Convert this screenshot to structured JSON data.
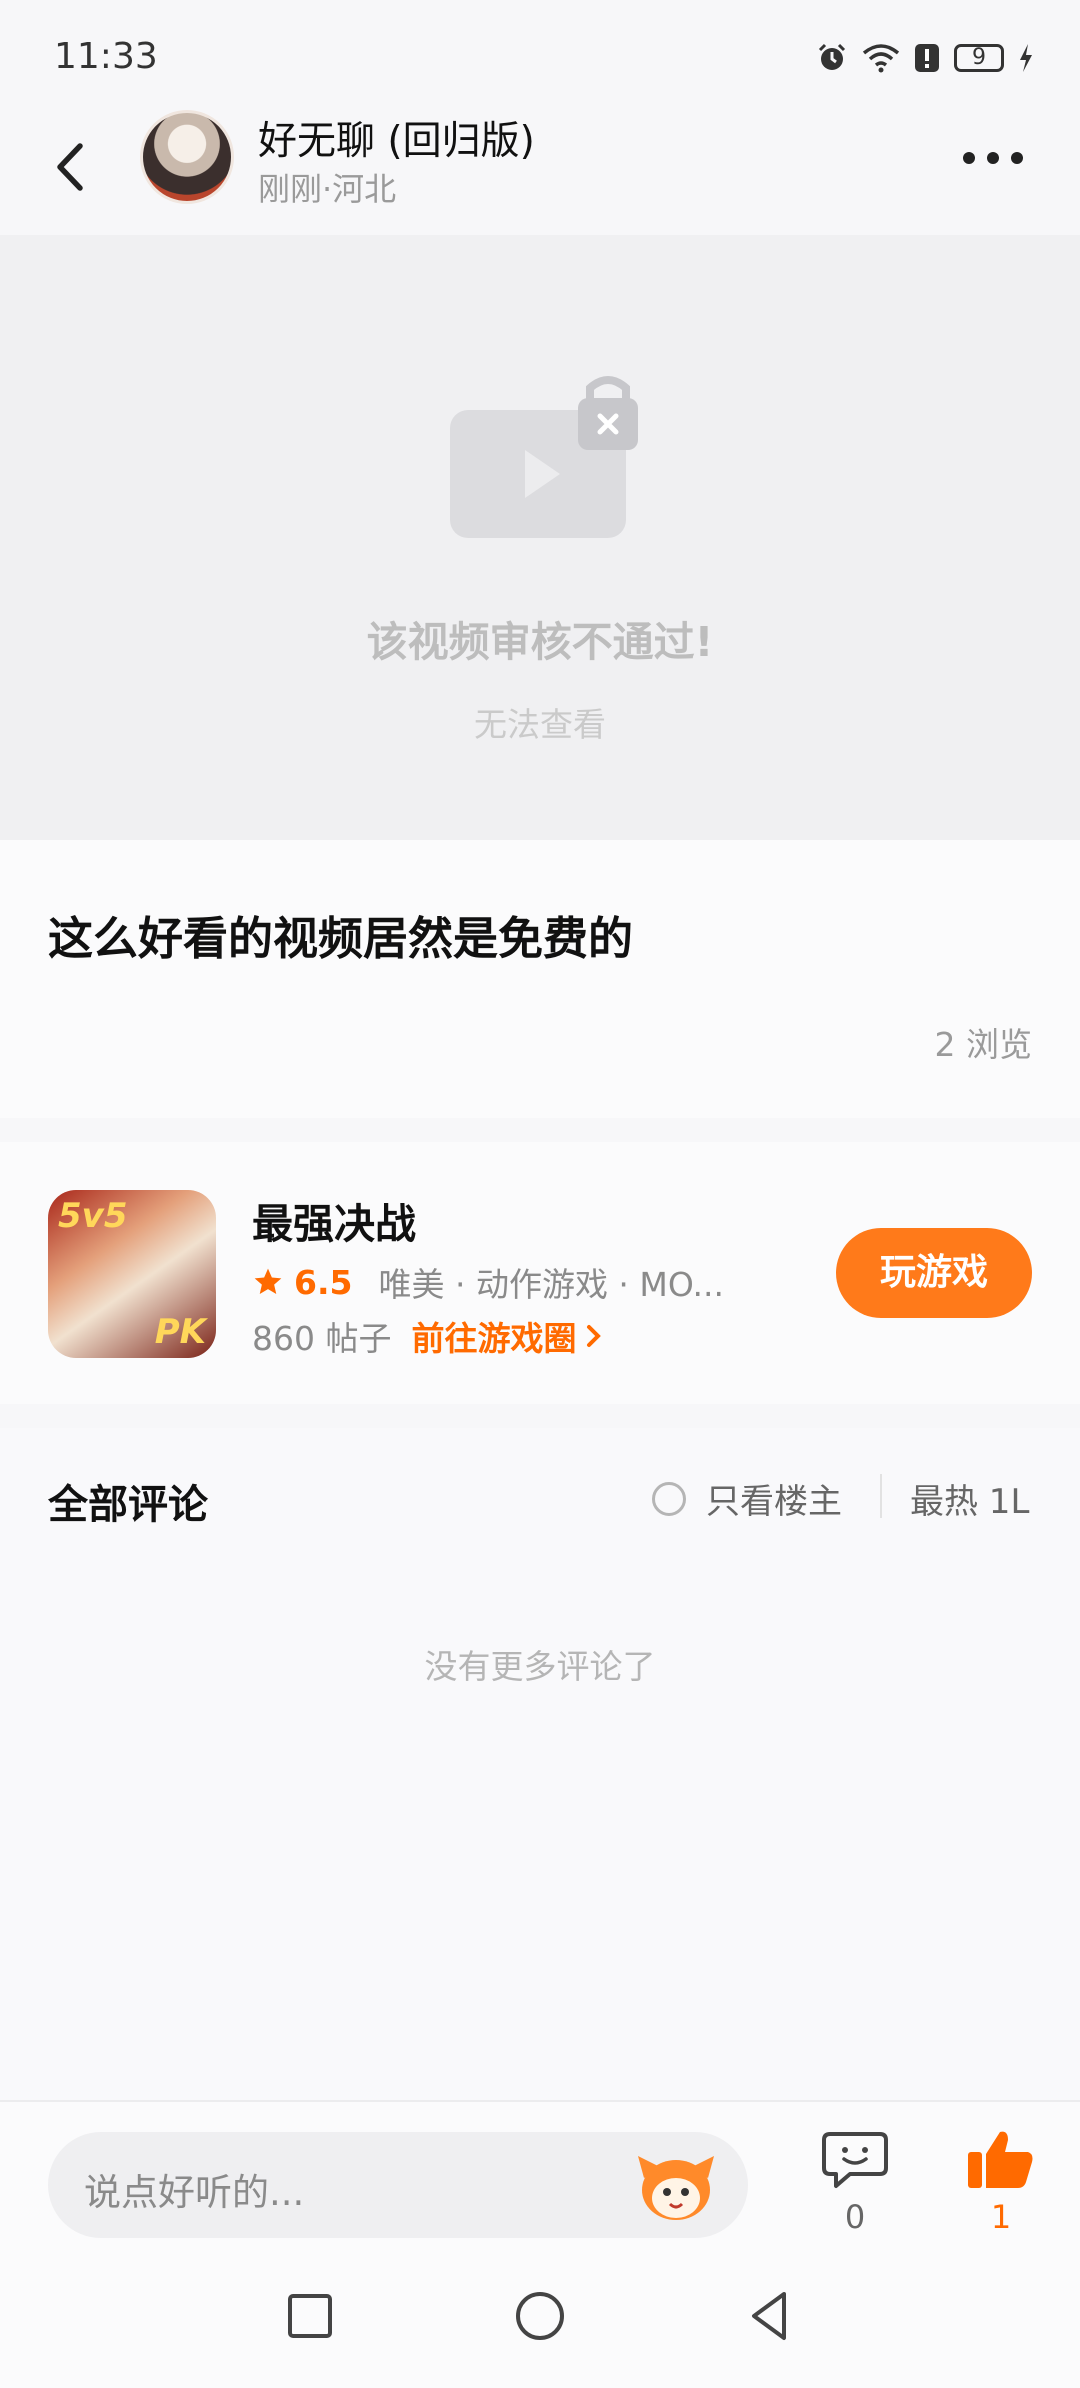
{
  "status_bar": {
    "time": "11:33",
    "battery": "9",
    "icons": [
      "alarm-icon",
      "wifi-icon",
      "alert-icon",
      "battery-icon",
      "charging-icon"
    ]
  },
  "header": {
    "username": "好无聊 (回归版)",
    "time_location": "刚刚·河北",
    "back_icon": "chevron-left-icon",
    "more_icon": "more-icon"
  },
  "video": {
    "blocked_title": "该视频审核不通过!",
    "blocked_subtitle": "无法查看"
  },
  "post": {
    "title": "这么好看的视频居然是免费的",
    "views": "2 浏览"
  },
  "game_card": {
    "icon_text_top": "5v5",
    "icon_text_bottom": "PK",
    "name": "最强决战",
    "rating": "6.5",
    "tags": "唯美 · 动作游戏 · MO...",
    "posts": "860 帖子",
    "circle_link": "前往游戏圈",
    "play_button": "玩游戏"
  },
  "comments": {
    "title": "全部评论",
    "only_owner": "只看楼主",
    "sort": "最热 1L",
    "empty": "没有更多评论了"
  },
  "bottom_bar": {
    "input_placeholder": "说点好听的...",
    "comment_count": "0",
    "like_count": "1"
  },
  "colors": {
    "accent": "#ff7a1a",
    "rating": "#ff6a00",
    "background": "#f7f7f9"
  }
}
